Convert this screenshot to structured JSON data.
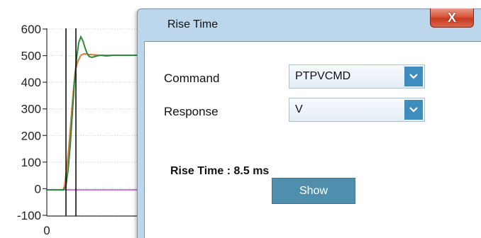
{
  "chart_data": {
    "type": "line",
    "y_ticks": [
      "600",
      "500",
      "400",
      "300",
      "200",
      "100",
      "0",
      "-100"
    ],
    "x_ticks": [
      "0"
    ],
    "ylim": [
      -100,
      600
    ],
    "colors": {
      "command": "#e07a45",
      "response": "#2e8b3a",
      "reference": "#c87de0",
      "cursor": "#000000"
    }
  },
  "dialog": {
    "title": "Rise Time",
    "close_label": "X",
    "command_label": "Command",
    "command_value": "PTPVCMD",
    "response_label": "Response",
    "response_value": "V",
    "rise_time_text": "Rise Time : 8.5 ms",
    "show_label": "Show"
  }
}
